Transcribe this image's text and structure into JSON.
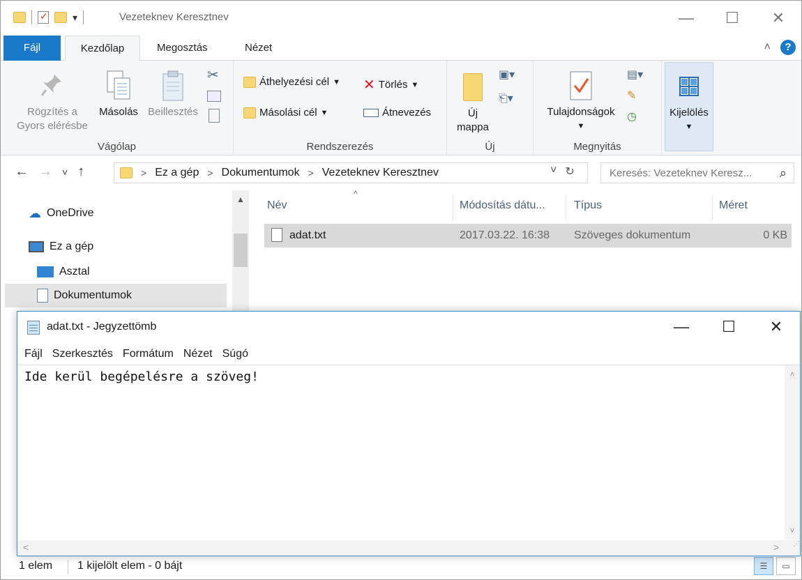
{
  "explorer": {
    "title": "Vezeteknev Keresztnev",
    "window_controls": {
      "minimize": "—",
      "maximize": "☐",
      "close": "✕"
    },
    "qat_dropdown": "▾",
    "tabs": {
      "file": "Fájl",
      "home": "Kezdőlap",
      "share": "Megosztás",
      "view": "Nézet"
    },
    "ribbon_collapse": "˄",
    "help": "?",
    "ribbon": {
      "clipboard": {
        "label": "Vágólap",
        "pin_line1": "Rögzítés a",
        "pin_line2": "Gyors elérésbe",
        "copy": "Másolás",
        "paste": "Beillesztés"
      },
      "organize": {
        "label": "Rendszerezés",
        "move_to": "Áthelyezési cél",
        "copy_to": "Másolási cél",
        "delete": "Törlés",
        "rename": "Átnevezés"
      },
      "new": {
        "label": "Új",
        "new_folder_line1": "Új",
        "new_folder_line2": "mappa"
      },
      "open": {
        "label": "Megnyitás",
        "properties": "Tulajdonságok"
      },
      "select": {
        "label": "Kijelölés"
      }
    },
    "address": {
      "back": "←",
      "forward": "→",
      "recent": "˅",
      "up": "↑",
      "crumbs": [
        "Ez a gép",
        "Dokumentumok",
        "Vezeteknev Keresztnev"
      ],
      "separator": ">",
      "dropdown": "˅",
      "refresh": "↻"
    },
    "search": {
      "placeholder": "Keresés: Vezeteknev Keresz...",
      "icon": "⌕"
    },
    "nav": {
      "onedrive": "OneDrive",
      "this_pc": "Ez a gép",
      "desktop": "Asztal",
      "documents": "Dokumentumok"
    },
    "columns": {
      "name": "Név",
      "modified": "Módosítás dátu...",
      "type": "Típus",
      "size": "Méret"
    },
    "files": [
      {
        "name": "adat.txt",
        "modified": "2017.03.22. 16:38",
        "type": "Szöveges dokumentum",
        "size": "0 KB"
      }
    ],
    "status": {
      "count": "1 elem",
      "selection": "1 kijelölt elem - 0 bájt"
    }
  },
  "notepad": {
    "title": "adat.txt - Jegyzettömb",
    "controls": {
      "minimize": "—",
      "maximize": "☐",
      "close": "✕"
    },
    "menu": {
      "file": "Fájl",
      "edit": "Szerkesztés",
      "format": "Formátum",
      "view": "Nézet",
      "help": "Súgó"
    },
    "content": "Ide kerül begépelésre a szöveg!"
  },
  "colors": {
    "accent": "#1979ca",
    "selection": "#d9d9d9",
    "delete": "#e81123"
  }
}
